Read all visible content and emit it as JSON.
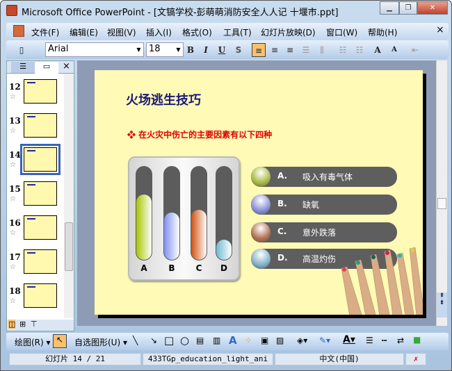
{
  "window": {
    "title": "Microsoft Office PowerPoint - [文镐学校-彭萌萌消防安全人人记  十堰市.ppt]",
    "minimize": "▁",
    "restore": "❐",
    "close": "✕"
  },
  "menu": [
    "文件(F)",
    "编辑(E)",
    "视图(V)",
    "插入(I)",
    "格式(O)",
    "工具(T)",
    "幻灯片放映(D)",
    "窗口(W)",
    "帮助(H)"
  ],
  "menu_close": "×",
  "toolbar": {
    "font": "Arial",
    "size": "18",
    "bold": "B",
    "italic": "I",
    "underline": "U",
    "shadow": "S",
    "align_left_active": true
  },
  "thumbnails": [
    {
      "num": "12"
    },
    {
      "num": "13"
    },
    {
      "num": "14",
      "selected": true
    },
    {
      "num": "15"
    },
    {
      "num": "16"
    },
    {
      "num": "17"
    },
    {
      "num": "18"
    }
  ],
  "slide": {
    "title": "火场逃生技巧",
    "bullet": "❖ 在火灾中伤亡的主要因素有以下四种",
    "bars": [
      {
        "label": "A",
        "level": 0.7,
        "color": "#a8c400"
      },
      {
        "label": "B",
        "level": 0.51,
        "color": "#8090f0"
      },
      {
        "label": "C",
        "level": 0.54,
        "color": "#d05010"
      },
      {
        "label": "D",
        "level": 0.22,
        "color": "#70b8d0"
      }
    ],
    "options": [
      {
        "letter": "A.",
        "text": "吸入有毒气体",
        "color": "#a8b840"
      },
      {
        "letter": "B.",
        "text": "缺氧",
        "color": "#8890d8"
      },
      {
        "letter": "C.",
        "text": "意外跌落",
        "color": "#b07050"
      },
      {
        "letter": "D.",
        "text": "高温灼伤",
        "color": "#80b0c8"
      }
    ]
  },
  "drawbar": {
    "draw": "绘图(R) ▾",
    "autoshapes": "自选图形(U) ▾"
  },
  "status": {
    "slide": "幻灯片 14 / 21",
    "template": "433TGp_education_light_ani",
    "language": "中文(中国)"
  }
}
